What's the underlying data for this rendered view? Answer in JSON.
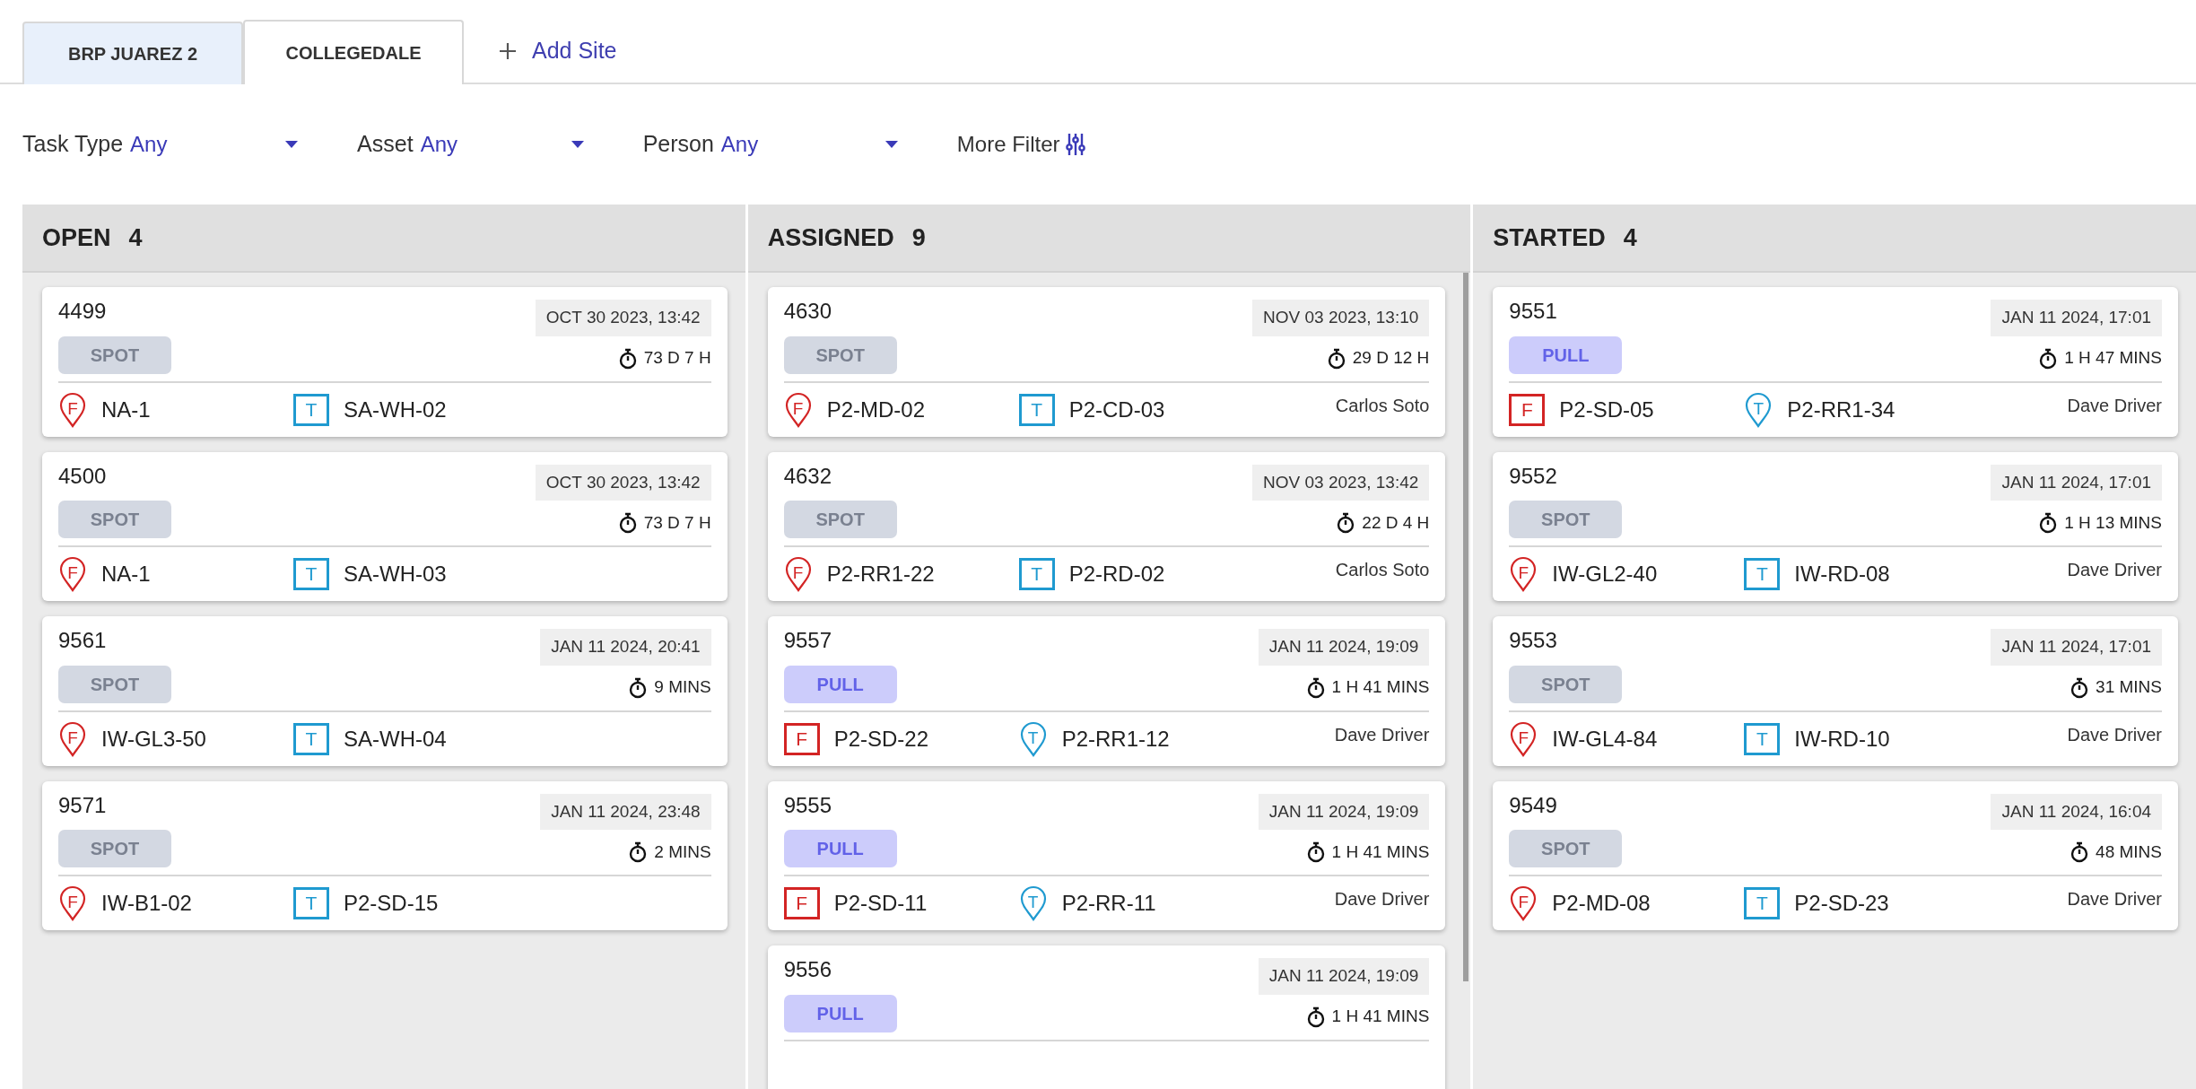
{
  "site_tabs": [
    {
      "label": "BRP JUAREZ 2",
      "selected": false
    },
    {
      "label": "COLLEGEDALE",
      "selected": true
    }
  ],
  "add_site": {
    "label": "Add Site"
  },
  "filters": [
    {
      "label": "Task Type",
      "value": "Any"
    },
    {
      "label": "Asset",
      "value": "Any"
    },
    {
      "label": "Person",
      "value": "Any"
    }
  ],
  "more_filter": {
    "label": "More Filter"
  },
  "columns": [
    {
      "title": "OPEN",
      "count": "4",
      "scrollbar": false,
      "cards": [
        {
          "id": "4499",
          "date": "OCT 30 2023, 13:42",
          "kind": "spot",
          "type": "SPOT",
          "elapsed": "73 D 7 H",
          "from": {
            "kind": "pin",
            "letter": "F",
            "location": "NA-1"
          },
          "to": {
            "kind": "square",
            "letter": "T",
            "location": "SA-WH-02"
          }
        },
        {
          "id": "4500",
          "date": "OCT 30 2023, 13:42",
          "kind": "spot",
          "type": "SPOT",
          "elapsed": "73 D 7 H",
          "from": {
            "kind": "pin",
            "letter": "F",
            "location": "NA-1"
          },
          "to": {
            "kind": "square",
            "letter": "T",
            "location": "SA-WH-03"
          }
        },
        {
          "id": "9561",
          "date": "JAN 11 2024, 20:41",
          "kind": "spot",
          "type": "SPOT",
          "elapsed": "9 MINS",
          "from": {
            "kind": "pin",
            "letter": "F",
            "location": "IW-GL3-50"
          },
          "to": {
            "kind": "square",
            "letter": "T",
            "location": "SA-WH-04"
          }
        },
        {
          "id": "9571",
          "date": "JAN 11 2024, 23:48",
          "kind": "spot",
          "type": "SPOT",
          "elapsed": "2 MINS",
          "from": {
            "kind": "pin",
            "letter": "F",
            "location": "IW-B1-02"
          },
          "to": {
            "kind": "square",
            "letter": "T",
            "location": "P2-SD-15"
          }
        }
      ]
    },
    {
      "title": "ASSIGNED",
      "count": "9",
      "scrollbar": true,
      "cards": [
        {
          "id": "4630",
          "date": "NOV 03 2023, 13:10",
          "kind": "spot",
          "type": "SPOT",
          "elapsed": "29 D 12 H",
          "from": {
            "kind": "pin",
            "letter": "F",
            "location": "P2-MD-02"
          },
          "to": {
            "kind": "square",
            "letter": "T",
            "location": "P2-CD-03"
          },
          "person": "Carlos Soto"
        },
        {
          "id": "4632",
          "date": "NOV 03 2023, 13:42",
          "kind": "spot",
          "type": "SPOT",
          "elapsed": "22 D 4 H",
          "from": {
            "kind": "pin",
            "letter": "F",
            "location": "P2-RR1-22"
          },
          "to": {
            "kind": "square",
            "letter": "T",
            "location": "P2-RD-02"
          },
          "person": "Carlos Soto"
        },
        {
          "id": "9557",
          "date": "JAN 11 2024, 19:09",
          "kind": "pull",
          "type": "PULL",
          "elapsed": "1 H 41 MINS",
          "from": {
            "kind": "square",
            "letter": "F",
            "location": "P2-SD-22"
          },
          "to": {
            "kind": "pin",
            "letter": "T",
            "location": "P2-RR1-12"
          },
          "person": "Dave Driver"
        },
        {
          "id": "9555",
          "date": "JAN 11 2024, 19:09",
          "kind": "pull",
          "type": "PULL",
          "elapsed": "1 H 41 MINS",
          "from": {
            "kind": "square",
            "letter": "F",
            "location": "P2-SD-11"
          },
          "to": {
            "kind": "pin",
            "letter": "T",
            "location": "P2-RR-11"
          },
          "person": "Dave Driver"
        },
        {
          "id": "9556",
          "date": "JAN 11 2024, 19:09",
          "kind": "pull",
          "type": "PULL",
          "elapsed": "1 H 41 MINS"
        }
      ]
    },
    {
      "title": "STARTED",
      "count": "4",
      "scrollbar": false,
      "cards": [
        {
          "id": "9551",
          "date": "JAN 11 2024, 17:01",
          "kind": "pull",
          "type": "PULL",
          "elapsed": "1 H 47 MINS",
          "from": {
            "kind": "square",
            "letter": "F",
            "location": "P2-SD-05"
          },
          "to": {
            "kind": "pin",
            "letter": "T",
            "location": "P2-RR1-34"
          },
          "person": "Dave Driver"
        },
        {
          "id": "9552",
          "date": "JAN 11 2024, 17:01",
          "kind": "spot",
          "type": "SPOT",
          "elapsed": "1 H 13 MINS",
          "from": {
            "kind": "pin",
            "letter": "F",
            "location": "IW-GL2-40"
          },
          "to": {
            "kind": "square",
            "letter": "T",
            "location": "IW-RD-08"
          },
          "person": "Dave Driver"
        },
        {
          "id": "9553",
          "date": "JAN 11 2024, 17:01",
          "kind": "spot",
          "type": "SPOT",
          "elapsed": "31 MINS",
          "from": {
            "kind": "pin",
            "letter": "F",
            "location": "IW-GL4-84"
          },
          "to": {
            "kind": "square",
            "letter": "T",
            "location": "IW-RD-10"
          },
          "person": "Dave Driver"
        },
        {
          "id": "9549",
          "date": "JAN 11 2024, 16:04",
          "kind": "spot",
          "type": "SPOT",
          "elapsed": "48 MINS",
          "from": {
            "kind": "pin",
            "letter": "F",
            "location": "P2-MD-08"
          },
          "to": {
            "kind": "square",
            "letter": "T",
            "location": "P2-SD-23"
          },
          "person": "Dave Driver"
        }
      ]
    }
  ]
}
